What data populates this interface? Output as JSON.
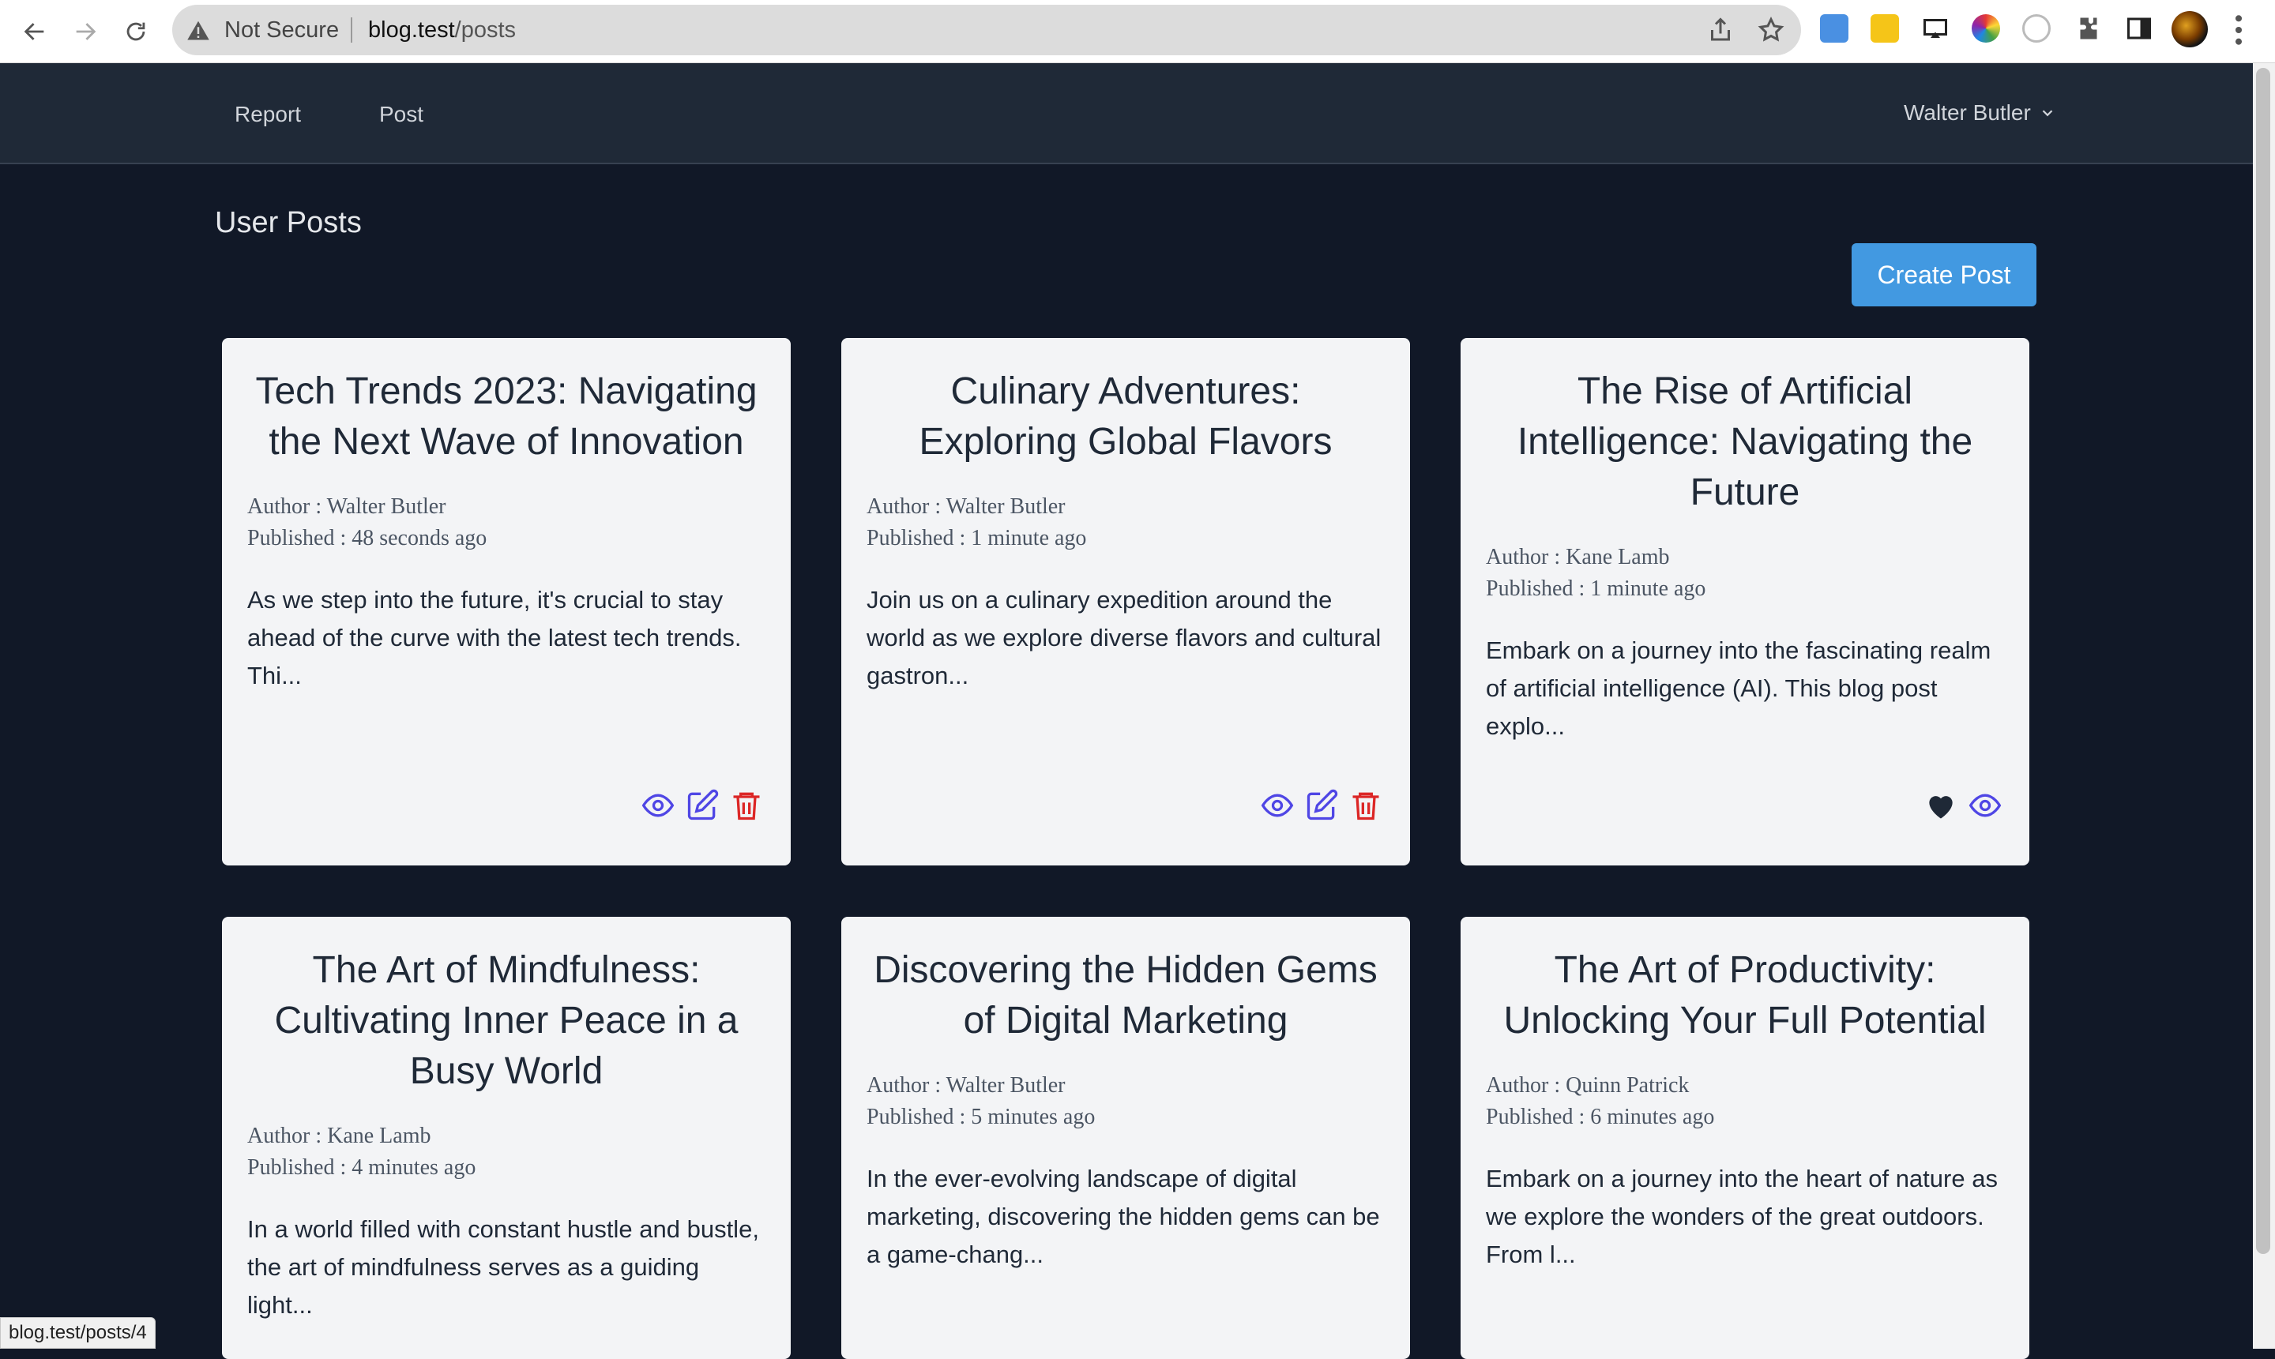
{
  "browser": {
    "security_label": "Not Secure",
    "url_host": "blog.test",
    "url_path": "/posts",
    "status_url": "blog.test/posts/4"
  },
  "nav": {
    "links": [
      "Report",
      "Post"
    ],
    "user_name": "Walter Butler"
  },
  "page": {
    "title": "User Posts",
    "create_label": "Create Post"
  },
  "posts": [
    {
      "title": "Tech Trends 2023: Navigating the Next Wave of Innovation",
      "author": "Author : Walter Butler",
      "published": "Published : 48 seconds ago",
      "excerpt": "As we step into the future, it's crucial to stay ahead of the curve with the latest tech trends. Thi...",
      "actions": [
        "eye-icon",
        "edit-icon",
        "trash-icon"
      ]
    },
    {
      "title": "Culinary Adventures: Exploring Global Flavors",
      "author": "Author : Walter Butler",
      "published": "Published : 1 minute ago",
      "excerpt": "Join us on a culinary expedition around the world as we explore diverse flavors and cultural gastron...",
      "actions": [
        "eye-icon",
        "edit-icon",
        "trash-icon"
      ]
    },
    {
      "title": "The Rise of Artificial Intelligence: Navigating the Future",
      "author": "Author : Kane Lamb",
      "published": "Published : 1 minute ago",
      "excerpt": "Embark on a journey into the fascinating realm of artificial intelligence (AI). This blog post explo...",
      "actions": [
        "heart-icon",
        "eye-icon"
      ]
    },
    {
      "title": "The Art of Mindfulness: Cultivating Inner Peace in a Busy World",
      "author": "Author : Kane Lamb",
      "published": "Published : 4 minutes ago",
      "excerpt": "In a world filled with constant hustle and bustle, the art of mindfulness serves as a guiding light...",
      "actions": []
    },
    {
      "title": "Discovering the Hidden Gems of Digital Marketing",
      "author": "Author : Walter Butler",
      "published": "Published : 5 minutes ago",
      "excerpt": "In the ever-evolving landscape of digital marketing, discovering the hidden gems can be a game-chang...",
      "actions": []
    },
    {
      "title": "The Art of Productivity: Unlocking Your Full Potential",
      "author": "Author : Quinn Patrick",
      "published": "Published : 6 minutes ago",
      "excerpt": "Embark on a journey into the heart of nature as we explore the wonders of the great outdoors. From l...",
      "actions": []
    }
  ],
  "colors": {
    "background": "#111827",
    "header": "#1f2937",
    "card": "#f3f4f6",
    "accent_blue": "#4299e1",
    "icon_indigo": "#4f46e5",
    "icon_red": "#dc2626"
  }
}
